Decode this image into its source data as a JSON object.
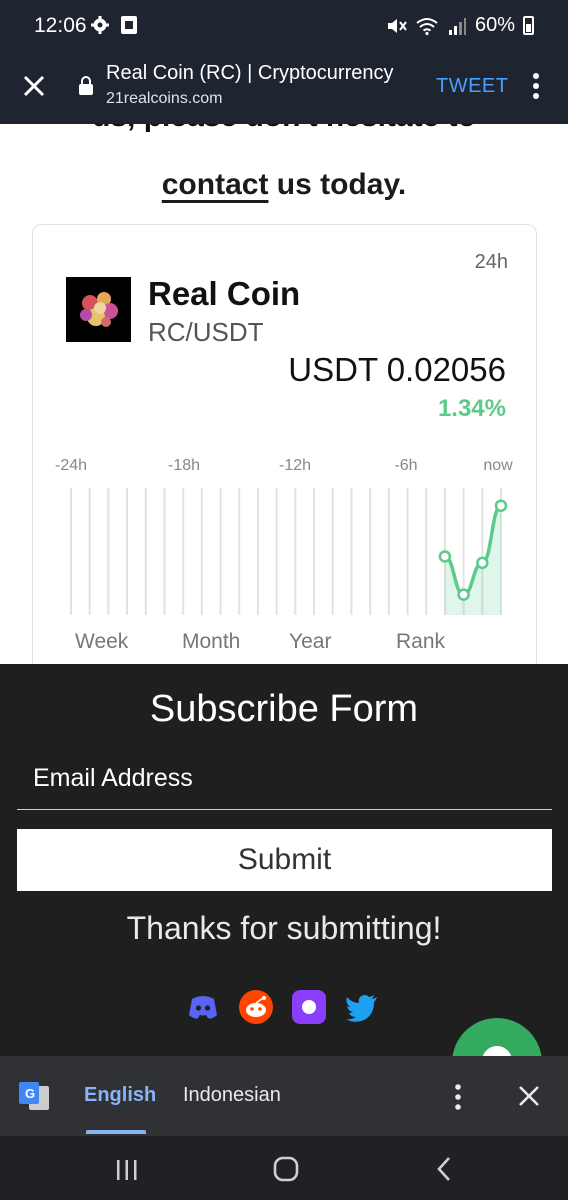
{
  "status_bar": {
    "time": "12:06",
    "battery": "60%"
  },
  "browser": {
    "title": "Real Coin (RC) | Cryptocurrency",
    "url": "21realcoins.com",
    "tweet_label": "TWEET"
  },
  "content": {
    "cut_text": "us, please don't hesitate to",
    "contact_link": "contact",
    "contact_rest": " us today."
  },
  "coin_card": {
    "period": "24h",
    "name": "Real Coin",
    "pair": "RC/USDT",
    "price": "USDT 0.02056",
    "change": "1.34%",
    "tabs": [
      "Week",
      "Month",
      "Year",
      "Rank"
    ]
  },
  "chart_data": {
    "type": "line",
    "x_tick_labels": [
      "-24h",
      "-18h",
      "-12h",
      "-6h",
      "now"
    ],
    "x": [
      "-3h",
      "-2h",
      "-1h",
      "now"
    ],
    "values": [
      0.0204,
      0.02028,
      0.02038,
      0.02056
    ],
    "line_color": "#5acb8a",
    "grid": true
  },
  "subscribe": {
    "title": "Subscribe Form",
    "email_label": "Email Address",
    "submit_label": "Submit",
    "thanks": "Thanks for submitting!",
    "social_icons": [
      "discord-icon",
      "reddit-icon",
      "kick-icon",
      "twitter-icon"
    ]
  },
  "translate_bar": {
    "language_selected": "English",
    "language_other": "Indonesian"
  }
}
